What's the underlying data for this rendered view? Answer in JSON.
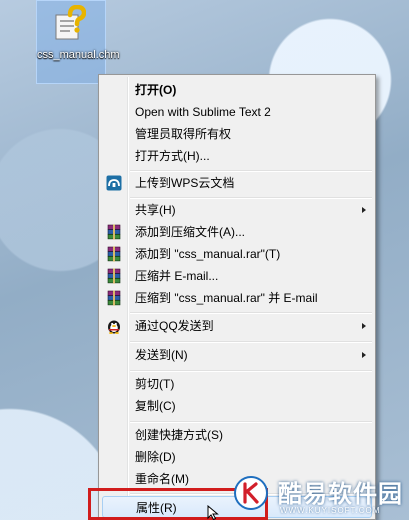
{
  "desktop": {
    "file": {
      "name": "css_manual.chm",
      "icon": "chm-help-file-icon"
    }
  },
  "context_menu": {
    "open": "打开(O)",
    "open_with_sublime": "Open with Sublime Text 2",
    "take_ownership": "管理员取得所有权",
    "open_with": "打开方式(H)...",
    "upload_wps": "上传到WPS云文档",
    "share": "共享(H)",
    "add_to_archive": "添加到压缩文件(A)...",
    "add_to_rar": "添加到 \"css_manual.rar\"(T)",
    "compress_email": "压缩并 E-mail...",
    "compress_rar_email": "压缩到 \"css_manual.rar\" 并 E-mail",
    "send_via_qq": "通过QQ发送到",
    "send_to": "发送到(N)",
    "cut": "剪切(T)",
    "copy": "复制(C)",
    "create_shortcut": "创建快捷方式(S)",
    "delete": "删除(D)",
    "rename": "重命名(M)",
    "properties": "属性(R)"
  },
  "watermark": {
    "brand": "酷易软件园",
    "site": "WWW.KUYISOFT.COM"
  },
  "colors": {
    "highlight_border": "#d11c1c",
    "menu_background": "#f0f0f0",
    "hover_fill": "#d9e9fb"
  }
}
